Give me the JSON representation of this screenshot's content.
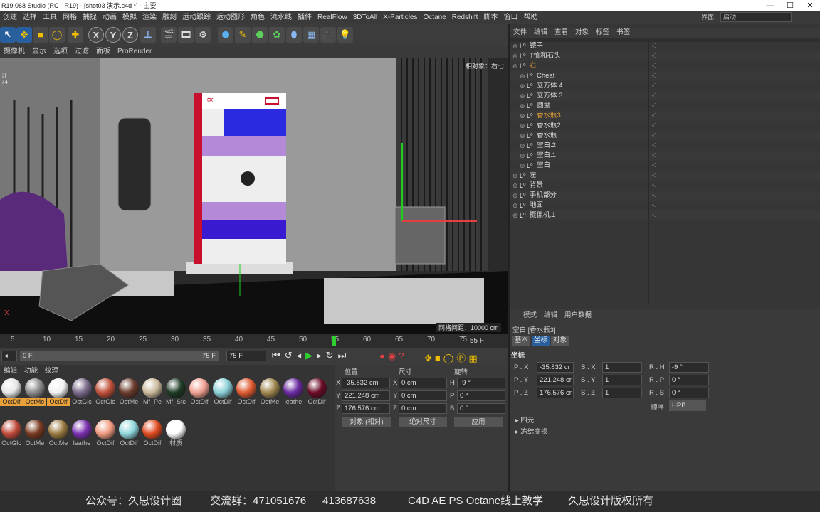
{
  "window": {
    "title": "R19.068 Studio (RC - R19) - [shot03 演示.c4d *] - 主要",
    "layout_label": "界面:",
    "layout_value": "启动"
  },
  "menu": [
    "创建",
    "选择",
    "工具",
    "网格",
    "捕捉",
    "动画",
    "模拟",
    "渲染",
    "雕刻",
    "运动跟踪",
    "运动图形",
    "角色",
    "流水线",
    "插件",
    "RealFlow",
    "3DToAll",
    "X-Particles",
    "Octane",
    "Redshift",
    "脚本",
    "窗口",
    "帮助"
  ],
  "toolbar": {
    "axis_x": "X",
    "axis_y": "Y",
    "axis_z": "Z"
  },
  "view_menu": [
    "摄像机",
    "显示",
    "选项",
    "过滤",
    "面板",
    "ProRender"
  ],
  "viewport": {
    "camera_label": "相对象：右七",
    "grid_distance": "网格间距：10000 cm",
    "axis_x_label": "X",
    "left_text": [
      "计",
      "74"
    ]
  },
  "timeline": {
    "ticks": [
      "5",
      "10",
      "15",
      "20",
      "25",
      "30",
      "35",
      "40",
      "45",
      "50",
      "55",
      "60",
      "65",
      "70",
      "75"
    ],
    "current_frame": "55 F"
  },
  "transport": {
    "start": "0 F",
    "end_inner": "75 F",
    "end": "75 F"
  },
  "material_menu": [
    "编辑",
    "功能",
    "纹理"
  ],
  "materials": [
    {
      "label": "OctDif",
      "color": "#e6e6e6",
      "selected": true
    },
    {
      "label": "OctMe",
      "color": "#8a8a8a",
      "selected": true
    },
    {
      "label": "OctDif",
      "color": "#f2f2f2",
      "selected": true
    },
    {
      "label": "OctGlc",
      "color": "#7a6a8a",
      "selected": false
    },
    {
      "label": "OctGlc",
      "color": "#c0503a",
      "selected": false
    },
    {
      "label": "OctMe",
      "color": "#6a3a2a",
      "selected": false
    },
    {
      "label": "Mf_Pe",
      "color": "#c9b89a",
      "selected": false
    },
    {
      "label": "Mf_Stc",
      "color": "#1e3a24",
      "selected": false
    },
    {
      "label": "OctDif",
      "color": "#f0a090",
      "selected": false
    },
    {
      "label": "OctDif",
      "color": "#8ad0d6",
      "selected": false
    },
    {
      "label": "OctDif",
      "color": "#e05a30",
      "selected": false
    },
    {
      "label": "OctMe",
      "color": "#a08850",
      "selected": false
    },
    {
      "label": "leathe",
      "color": "#6a2aa0",
      "selected": false
    },
    {
      "label": "OctDif",
      "color": "#6a0a24",
      "selected": false
    },
    {
      "label": "OctGlc",
      "color": "#c04a3a",
      "selected": false
    },
    {
      "label": "OctMe",
      "color": "#7a3a20",
      "selected": false
    },
    {
      "label": "OctMe",
      "color": "#9a7a40",
      "selected": false
    },
    {
      "label": "leathe",
      "color": "#7a30b0",
      "selected": false
    },
    {
      "label": "OctDif",
      "color": "#f09a80",
      "selected": false
    },
    {
      "label": "OctDif",
      "color": "#90d8dc",
      "selected": false
    },
    {
      "label": "OctDif",
      "color": "#e04a20",
      "selected": false
    },
    {
      "label": "材质",
      "color": "#ffffff",
      "selected": false
    }
  ],
  "coords": {
    "headers": {
      "pos": "位置",
      "size": "尺寸",
      "rot": "旋转"
    },
    "rows": [
      {
        "a": "X",
        "pos": "-35.832 cm",
        "s": "X",
        "size": "0 cm",
        "r": "H",
        "rot": "-9 °"
      },
      {
        "a": "Y",
        "pos": "221.248 cm",
        "s": "Y",
        "size": "0 cm",
        "r": "P",
        "rot": "0 °"
      },
      {
        "a": "Z",
        "pos": "176.576 cm",
        "s": "Z",
        "size": "0 cm",
        "r": "B",
        "rot": "0 °"
      }
    ],
    "mode": "对象 (相对)",
    "size_mode": "绝对尺寸",
    "apply": "应用"
  },
  "object_manager": {
    "menu": [
      "文件",
      "编辑",
      "查看",
      "对象",
      "标签",
      "书签"
    ],
    "rows": [
      {
        "name": "镜子",
        "indent": 0,
        "color": "#dcdcdc"
      },
      {
        "name": "T恤和石头",
        "indent": 0,
        "color": "#dcdcdc"
      },
      {
        "name": "右",
        "indent": 0,
        "color": "#e8a03a"
      },
      {
        "name": "Cheat",
        "indent": 1,
        "color": "#dcdcdc"
      },
      {
        "name": "立方体.4",
        "indent": 1,
        "color": "#dcdcdc"
      },
      {
        "name": "立方体.3",
        "indent": 1,
        "color": "#dcdcdc"
      },
      {
        "name": "圆盘",
        "indent": 1,
        "color": "#dcdcdc"
      },
      {
        "name": "香水瓶3",
        "indent": 1,
        "color": "#e8a03a"
      },
      {
        "name": "香水瓶2",
        "indent": 1,
        "color": "#dcdcdc"
      },
      {
        "name": "香水瓶",
        "indent": 1,
        "color": "#dcdcdc"
      },
      {
        "name": "空白.2",
        "indent": 1,
        "color": "#dcdcdc"
      },
      {
        "name": "空白.1",
        "indent": 1,
        "color": "#dcdcdc"
      },
      {
        "name": "空白",
        "indent": 1,
        "color": "#dcdcdc"
      },
      {
        "name": "左",
        "indent": 0,
        "color": "#dcdcdc"
      },
      {
        "name": "背景",
        "indent": 0,
        "color": "#dcdcdc"
      },
      {
        "name": "手机部分",
        "indent": 0,
        "color": "#dcdcdc"
      },
      {
        "name": "地面",
        "indent": 0,
        "color": "#dcdcdc"
      },
      {
        "name": "摄像机.1",
        "indent": 0,
        "color": "#dcdcdc"
      }
    ]
  },
  "attributes": {
    "menu": [
      "模式",
      "编辑",
      "用户数据"
    ],
    "object_title": "空白 [香水瓶3]",
    "tabs": [
      "基本",
      "坐标",
      "对象"
    ],
    "section": "坐标",
    "rows": [
      {
        "p": "P . X",
        "pv": "-35.832 cr",
        "s": "S . X",
        "sv": "1",
        "r": "R . H",
        "rv": "-9 °"
      },
      {
        "p": "P . Y",
        "pv": "221.248 cr",
        "s": "S . Y",
        "sv": "1",
        "r": "R . P",
        "rv": "0 °"
      },
      {
        "p": "P . Z",
        "pv": "176.576 cr",
        "s": "S . Z",
        "sv": "1",
        "r": "R . B",
        "rv": "0 °"
      }
    ],
    "order_label": "顺序",
    "order_value": "HPB",
    "groups": [
      "四元",
      "冻结变换"
    ]
  },
  "phone": {
    "battery": "battery-icon",
    "wifi": "wifi-icon"
  },
  "footer": {
    "wechat": "公众号：久思设计圈",
    "group_label": "交流群：471051676",
    "group_2": "413687638",
    "teaching": "C4D AE PS Octane线上教学",
    "copyright": "久思设计版权所有"
  }
}
